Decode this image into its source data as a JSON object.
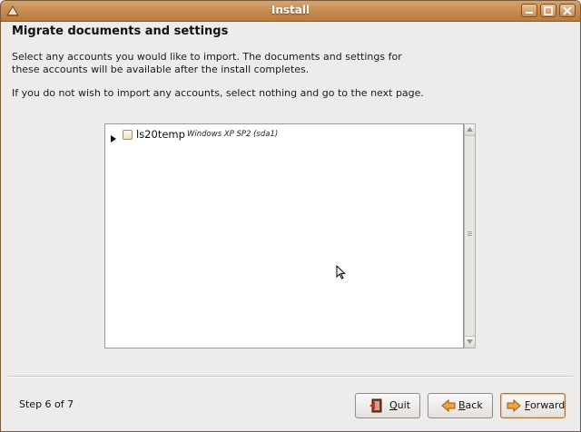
{
  "window": {
    "title": "Install"
  },
  "page": {
    "heading": "Migrate documents and settings",
    "description": "Select any accounts you would like to import.  The documents and settings for these accounts will be available after the install completes.",
    "hint": "If you do not wish to import any accounts, select nothing and go to the next page."
  },
  "accounts": [
    {
      "name": "ls20temp",
      "os": "Windows XP SP2 (sda1)",
      "checked": false,
      "expanded": false
    }
  ],
  "footer": {
    "step": "Step 6 of 7",
    "quit_mnemonic": "Q",
    "quit_rest": "uit",
    "back_mnemonic": "B",
    "back_rest": "ack",
    "forward_mnemonic": "F",
    "forward_rest": "orward"
  },
  "colors": {
    "titlebar": "#c4874c",
    "accent": "#d98a3a",
    "background": "#edeceb"
  }
}
